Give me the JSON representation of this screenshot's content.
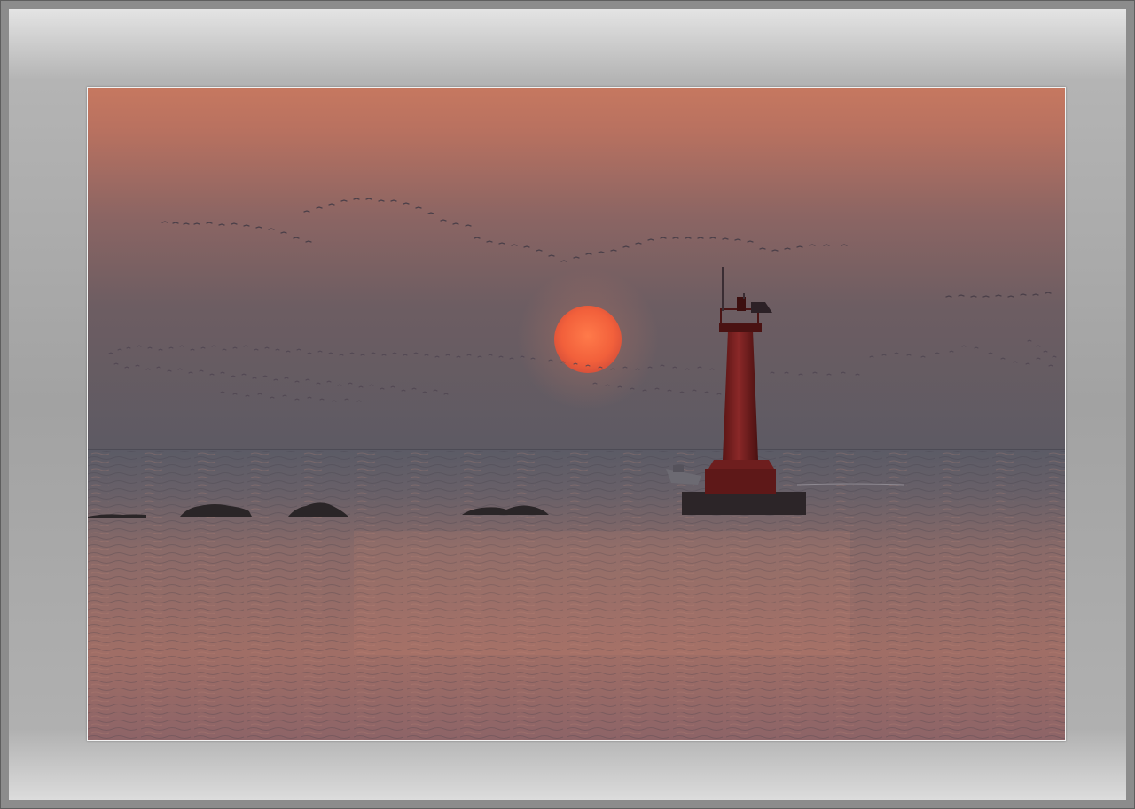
{
  "photo": {
    "sky_top": "#c97a5f",
    "sky_mid": "#7c6262",
    "sky_horizon": "#5e5a63",
    "sea_near": "#9a6e66",
    "sun": "#f06a3f",
    "lighthouse": "#7a2424",
    "frame_color": "#a6a6a6"
  }
}
